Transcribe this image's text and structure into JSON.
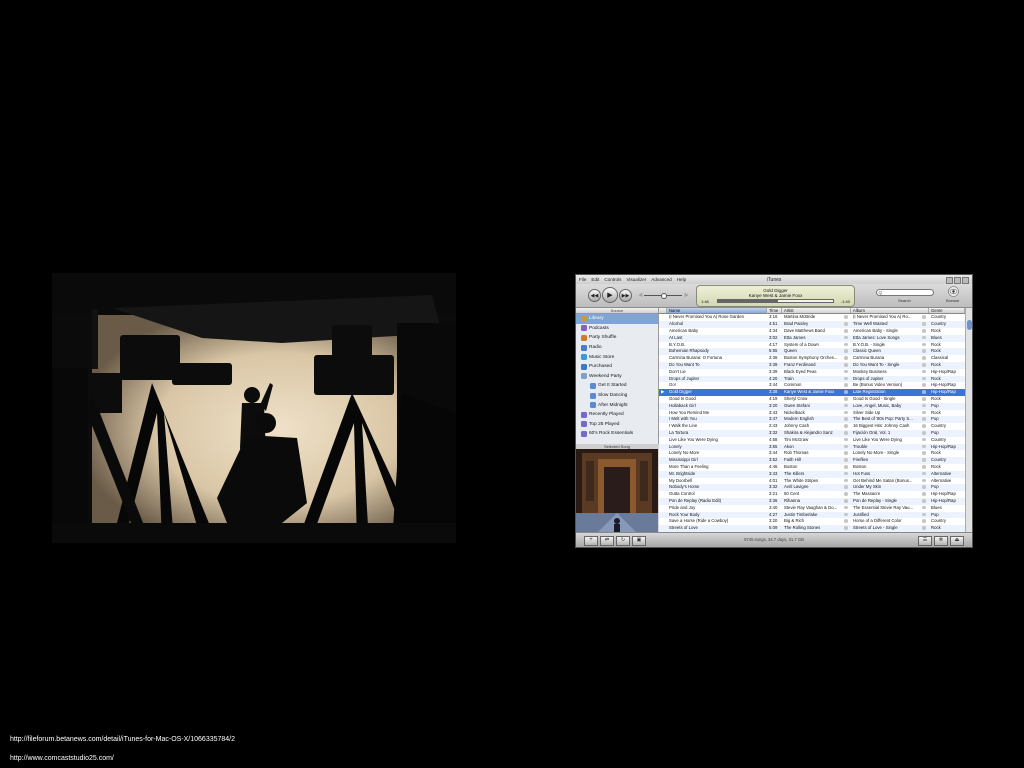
{
  "captions": {
    "line1": "http://fileforum.betanews.com/detail/iTunes-for-Mac-OS-X/1066335784/2",
    "line2": "http://www.comcaststudio25.com/"
  },
  "itunes": {
    "title": "iTunes",
    "menu": [
      "File",
      "Edit",
      "Controls",
      "Visualizer",
      "Advanced",
      "Help"
    ],
    "now_playing": {
      "song": "Gold Digger",
      "artist": "Kanye West & Jamie Foxx",
      "elapsed": "1:48",
      "remaining": "-1:40",
      "progress": 0.52
    },
    "volume": 0.5,
    "search_label": "Search",
    "search_placeholder": "Q",
    "browse_label": "Browse",
    "source_header": "Source",
    "sources": [
      {
        "label": "Library",
        "icon": "library-icon",
        "color": "#c89b3a",
        "selected": true,
        "sub": false
      },
      {
        "label": "Podcasts",
        "icon": "podcast-icon",
        "color": "#8a5bc9",
        "selected": false,
        "sub": false
      },
      {
        "label": "Party Shuffle",
        "icon": "party-shuffle-icon",
        "color": "#d07a2c",
        "selected": false,
        "sub": false
      },
      {
        "label": "Radio",
        "icon": "radio-icon",
        "color": "#4a7ac8",
        "selected": false,
        "sub": false
      },
      {
        "label": "Music Store",
        "icon": "music-store-icon",
        "color": "#3a9ad8",
        "selected": false,
        "sub": false
      },
      {
        "label": "Purchased",
        "icon": "purchased-icon",
        "color": "#3c78c8",
        "selected": false,
        "sub": false
      },
      {
        "label": "Weekend Party",
        "icon": "folder-icon",
        "color": "#7e9fc8",
        "selected": false,
        "sub": false
      },
      {
        "label": "Get It Started",
        "icon": "playlist-icon",
        "color": "#5a8ad2",
        "selected": false,
        "sub": true
      },
      {
        "label": "Slow Dancing",
        "icon": "playlist-icon",
        "color": "#5a8ad2",
        "selected": false,
        "sub": true
      },
      {
        "label": "After Midnight",
        "icon": "playlist-icon",
        "color": "#5a8ad2",
        "selected": false,
        "sub": true
      },
      {
        "label": "Recently Played",
        "icon": "smart-playlist-icon",
        "color": "#7868c8",
        "selected": false,
        "sub": false
      },
      {
        "label": "Top 25 Played",
        "icon": "smart-playlist-icon",
        "color": "#7868c8",
        "selected": false,
        "sub": false
      },
      {
        "label": "60's Rock Essentials",
        "icon": "smart-playlist-icon",
        "color": "#7868c8",
        "selected": false,
        "sub": false
      }
    ],
    "artwork_header": "Selected Song",
    "columns": {
      "name": "Name",
      "time": "Time",
      "artist": "Artist",
      "album": "Album",
      "genre": "Genre"
    },
    "tracks": [
      [
        "(I Never Promised You A) Rose Garden",
        "3:16",
        "Martina McBride",
        "(I Never Promised You A) Ro...",
        "Country"
      ],
      [
        "Alcohol",
        "4:51",
        "Brad Paisley",
        "Time Well Wasted",
        "Country"
      ],
      [
        "American Baby",
        "4:34",
        "Dave Matthews Band",
        "American Baby - Single",
        "Rock"
      ],
      [
        "At Last",
        "3:02",
        "Etta James",
        "Etta James: Love Songs",
        "Blues"
      ],
      [
        "B.Y.O.B.",
        "4:17",
        "System of a Down",
        "B.Y.O.B. - Single",
        "Rock"
      ],
      [
        "Bohemian Rhapsody",
        "5:55",
        "Queen",
        "Classic Queen",
        "Rock"
      ],
      [
        "Carmina Burana: O Fortuna",
        "2:36",
        "Boston Symphony Orches...",
        "Carmina Burana",
        "Classical"
      ],
      [
        "Do You Want To",
        "3:39",
        "Franz Ferdinand",
        "Do You Want To - Single",
        "Rock"
      ],
      [
        "Don't Lie",
        "3:39",
        "Black Eyed Peas",
        "Monkey Business",
        "Hip-Hop/Rap"
      ],
      [
        "Drops of Jupiter",
        "4:20",
        "Train",
        "Drops of Jupiter",
        "Rock"
      ],
      [
        "Go!",
        "3:44",
        "Common",
        "Be (Bonus Video Version)",
        "Hip-Hop/Rap"
      ],
      [
        "Gold Digger",
        "3:28",
        "Kanye West & Jamie Foxx",
        "Late Registration",
        "Hip-Hop/Rap"
      ],
      [
        "Good Is Good",
        "4:19",
        "Sheryl Crow",
        "Good Is Good - Single",
        "Rock"
      ],
      [
        "Hollaback Girl",
        "3:20",
        "Gwen Stefani",
        "Love, Angel, Music, Baby",
        "Pop"
      ],
      [
        "How You Remind Me",
        "3:43",
        "Nickelback",
        "Silver Side Up",
        "Rock"
      ],
      [
        "I Melt with You",
        "3:47",
        "Modern English",
        "The Best of '80s Pop: Party S...",
        "Pop"
      ],
      [
        "I Walk the Line",
        "2:43",
        "Johnny Cash",
        "16 Biggest Hits: Johnny Cash",
        "Country"
      ],
      [
        "La Tortura",
        "3:32",
        "Shakira & Alejandro Sanz",
        "Fijación Oral, Vol. 1",
        "Pop"
      ],
      [
        "Live Like You Were Dying",
        "4:58",
        "Tim McGraw",
        "Live Like You Were Dying",
        "Country"
      ],
      [
        "Lonely",
        "3:55",
        "Akon",
        "Trouble",
        "Hip-Hop/Rap"
      ],
      [
        "Lonely No More",
        "3:44",
        "Rob Thomas",
        "Lonely No More - Single",
        "Rock"
      ],
      [
        "Mississippi Girl",
        "3:52",
        "Faith Hill",
        "Fireflies",
        "Country"
      ],
      [
        "More Than a Feeling",
        "4:46",
        "Boston",
        "Boston",
        "Rock"
      ],
      [
        "Mr. Brightside",
        "3:43",
        "The Killers",
        "Hot Fuss",
        "Alternative"
      ],
      [
        "My Doorbell",
        "4:01",
        "The White Stripes",
        "Get Behind Me Satan (Bonus...",
        "Alternative"
      ],
      [
        "Nobody's Home",
        "3:32",
        "Avril Lavigne",
        "Under My Skin",
        "Pop"
      ],
      [
        "Outta Control",
        "3:21",
        "50 Cent",
        "The Massacre",
        "Hip-Hop/Rap"
      ],
      [
        "Pon de Replay (Radio Edit)",
        "3:36",
        "Rihanna",
        "Pon de Replay - Single",
        "Hip-Hop/Rap"
      ],
      [
        "Pride and Joy",
        "3:40",
        "Stevie Ray Vaughan & Do...",
        "The Essential Stevie Ray Vau...",
        "Blues"
      ],
      [
        "Rock Your Body",
        "4:27",
        "Justin Timberlake",
        "Justified",
        "Pop"
      ],
      [
        "Save a Horse (Ride a Cowboy)",
        "3:20",
        "Big & Rich",
        "Horse of a Different Color",
        "Country"
      ],
      [
        "Streets of Love",
        "5:09",
        "The Rolling Stones",
        "Streets of Love - Single",
        "Rock"
      ]
    ],
    "playing_index": 11,
    "status": "9745 songs, 34.7 days, 31.7 GB"
  }
}
